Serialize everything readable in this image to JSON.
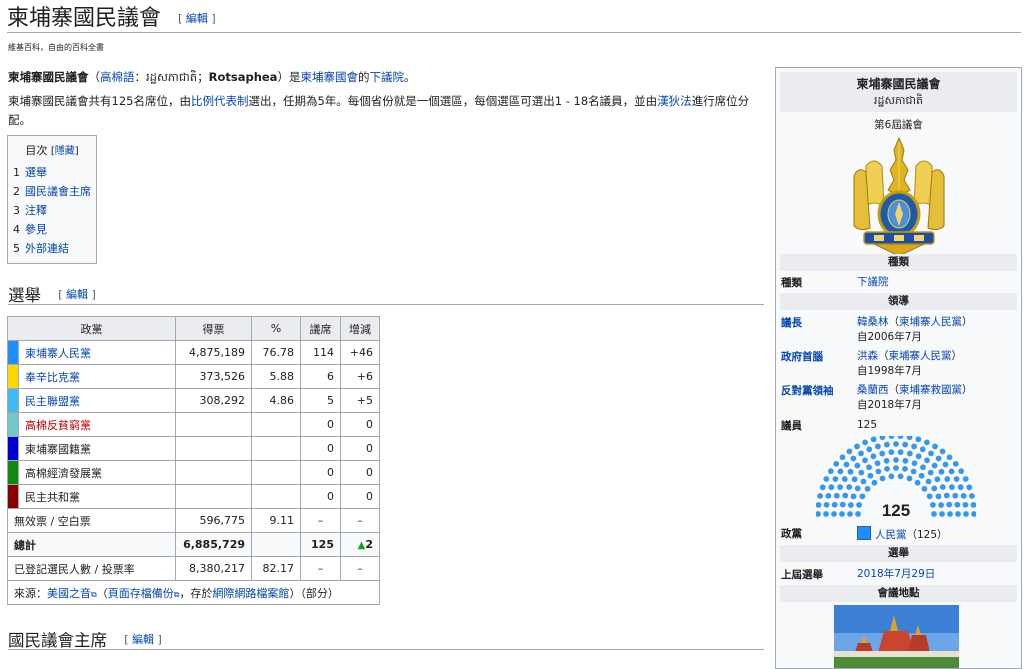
{
  "page": {
    "title": "柬埔寨國民議會",
    "edit_label": "編輯",
    "tagline": "維基百科，自由的百科全書"
  },
  "intro": {
    "p1": {
      "name": "柬埔寨國民議會",
      "paren_open": "（",
      "lang_link": "高棉語",
      "colon": "：",
      "khmer": "រដ្ឋសភាជាតិ",
      "semicolon": "；",
      "romanized": "Rotsaphea",
      "paren_close": "）",
      "is": "是",
      "parliament_link": "柬埔寨國會",
      "of": "的",
      "lower_house_link": "下議院",
      "end": "。"
    },
    "p2": {
      "t1": "柬埔寨國民議會共有125名席位，由",
      "pr_link": "比例代表制",
      "t2": "選出，任期為5年。每個省份就是一個選區，每個選區可選出1 - 18名議員，並由",
      "dhondt_link": "漢狄法",
      "t3": "進行席位分配。"
    }
  },
  "toc": {
    "title": "目次",
    "hide_open": "[",
    "hide_label": "隱藏",
    "hide_close": "]",
    "items": [
      {
        "num": "1",
        "label": "選舉"
      },
      {
        "num": "2",
        "label": "國民議會主席"
      },
      {
        "num": "3",
        "label": "注釋"
      },
      {
        "num": "4",
        "label": "參見"
      },
      {
        "num": "5",
        "label": "外部連結"
      }
    ]
  },
  "sections": {
    "elections": "選舉",
    "president": "國民議會主席"
  },
  "results_table": {
    "headers": {
      "party": "政黨",
      "votes": "得票",
      "pct": "%",
      "seats": "議席",
      "change": "增減"
    },
    "colors": [
      "#1f8fff",
      "#ffd700",
      "#3fb8f4",
      "#71c8c8",
      "#0000cc",
      "#118811",
      "#880000"
    ],
    "rows": [
      {
        "party": "柬埔寨人民黨",
        "votes": "4,875,189",
        "pct": "76.78",
        "seats": "114",
        "change": "+46"
      },
      {
        "party": "奉辛比克黨",
        "votes": "373,526",
        "pct": "5.88",
        "seats": "6",
        "change": "+6"
      },
      {
        "party": "民主聯盟黨",
        "votes": "308,292",
        "pct": "4.86",
        "seats": "5",
        "change": "+5"
      },
      {
        "party": "高棉反貧窮黨",
        "votes": "",
        "pct": "",
        "seats": "0",
        "change": "0"
      },
      {
        "party": "柬埔寨國籍黨",
        "votes": "",
        "pct": "",
        "seats": "0",
        "change": "0"
      },
      {
        "party": "高棉經濟發展黨",
        "votes": "",
        "pct": "",
        "seats": "0",
        "change": "0"
      },
      {
        "party": "民主共和黨",
        "votes": "",
        "pct": "",
        "seats": "0",
        "change": "0"
      }
    ],
    "invalid": {
      "label": "無效票 / 空白票",
      "votes": "596,775",
      "pct": "9.11",
      "seats": "–",
      "change": "–"
    },
    "total": {
      "label": "總計",
      "votes": "6,885,729",
      "pct": "",
      "seats": "125",
      "arrow": "▲",
      "change": "2"
    },
    "registered": {
      "label": "已登記選民人數 / 投票率",
      "votes": "8,380,217",
      "pct": "82.17",
      "seats": "–",
      "change": "–"
    },
    "source": {
      "t1": "來源：",
      "voa_link": "美國之音",
      "ext1": "⧉",
      "t2": "（",
      "archive_link": "頁面存檔備份",
      "ext2": "⧉",
      "t3": "，存於",
      "wayback_link": "網際網路檔案館",
      "t4": "）（部分）"
    }
  },
  "infobox": {
    "name": "柬埔寨國民議會",
    "khmer": "រដ្ឋសភាជាតិ",
    "term": "第6屆議會",
    "sec_type": "種類",
    "type_label": "種類",
    "type_value": "下議院",
    "sec_leadership": "領導",
    "leaders": [
      {
        "role": "議長",
        "name": "韓桑林",
        "party": "柬埔寨人民黨",
        "since": "自2006年7月"
      },
      {
        "role": "政府首腦",
        "name": "洪森",
        "party": "柬埔寨人民黨",
        "since": "自1998年7月"
      },
      {
        "role": "反對黨領袖",
        "name": "桑蘭西",
        "party": "柬埔寨救國黨",
        "since": "自2018年7月"
      }
    ],
    "paren_open": "（",
    "paren_close": "）",
    "members_label": "議員",
    "members_value": "125",
    "seat_total": "125",
    "seat_color": "#3c96e6",
    "groups_label": "政黨",
    "groups_party": "人民黨",
    "groups_seats": "（125）",
    "sec_elections": "選舉",
    "last_election_label": "上屆選舉",
    "last_election_value": "2018年7月29日",
    "sec_meeting": "會議地點"
  }
}
